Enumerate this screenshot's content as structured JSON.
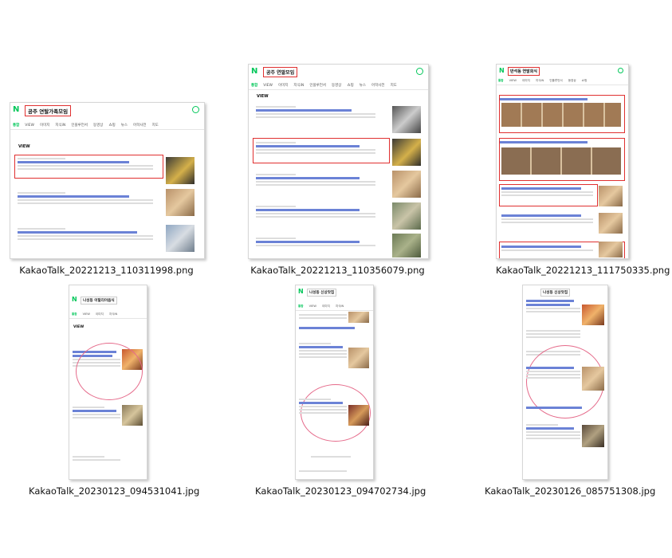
{
  "files": [
    {
      "name": "KakaoTalk_20221213_110311998.png",
      "query": "공주 연탈가족모임"
    },
    {
      "name": "KakaoTalk_20221213_110356079.png",
      "query": "공주 연말모임"
    },
    {
      "name": "KakaoTalk_20221213_111750335.png",
      "query": "반석동 연말회식"
    },
    {
      "name": "KakaoTalk_20230123_094531041.jpg",
      "query": "나성동 이탈리아음식"
    },
    {
      "name": "KakaoTalk_20230123_094702734.jpg",
      "query": "나성동 신상맛집"
    },
    {
      "name": "KakaoTalk_20230126_085751308.jpg",
      "query": "나성동 신상맛집"
    }
  ],
  "thumb_text": {
    "naver": "N",
    "tabs": [
      "통합",
      "VIEW",
      "이미지",
      "지식iN",
      "인플루언서",
      "동영상",
      "쇼핑",
      "뉴스",
      "어학사전",
      "지도"
    ],
    "view_label": "VIEW"
  },
  "colors": {
    "naver_green": "#03c75a",
    "highlight_red": "#e03030"
  }
}
